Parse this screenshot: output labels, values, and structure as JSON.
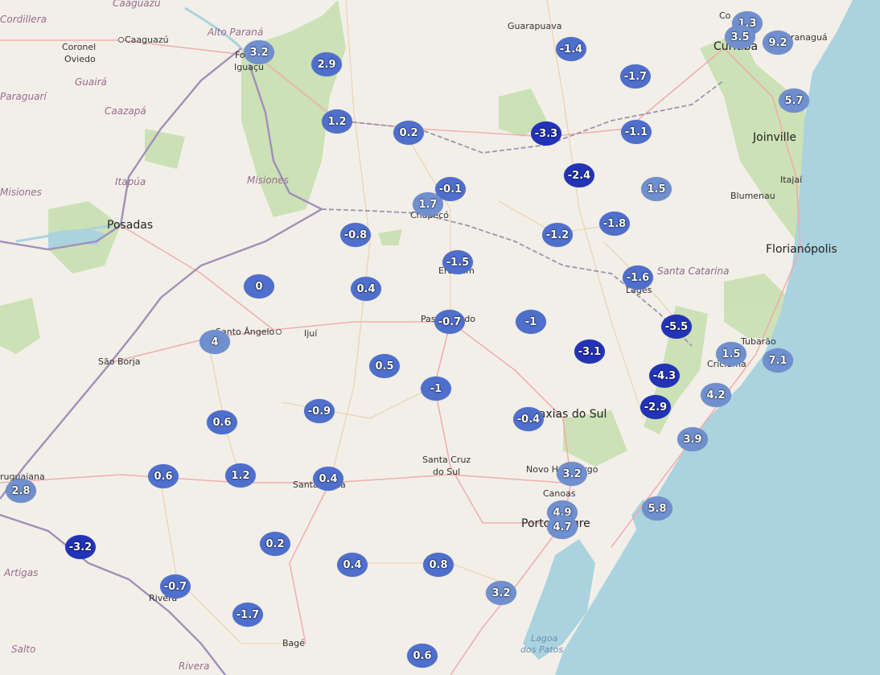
{
  "colors": {
    "land": "#f2efe9",
    "sea": "#aad3df",
    "forest": "#c8dfb0",
    "road_major": "#f2a8a8",
    "road_minor": "#e9c89a",
    "border": "#9d95ad",
    "river": "#aad3df",
    "marker_light": "#6f8fcf",
    "marker_mid": "#4f6fcd",
    "marker_dark": "#2233b8"
  },
  "labels": {
    "caaguazu_region": "Caaguazú",
    "cordillera": "Cordillera",
    "coronel_oviedo_1": "Coronel",
    "coronel_oviedo_2": "Oviedo",
    "caaguazu_city": "Caaguazú",
    "alto_parana": "Alto Paraná",
    "guaira": "Guairá",
    "paraguari": "Paraguarí",
    "caazapa": "Caazapá",
    "foz_1": "Fo",
    "foz_2": "Iguaçu",
    "itapua": "Itapúa",
    "misiones_ar": "Misiones",
    "misiones_py": "Misiones",
    "posadas": "Posadas",
    "guarapuava": "Guarapuava",
    "curitiba": "Curitiba",
    "colombo": "Co",
    "paranagua": "ranaguá",
    "joinville": "Joinville",
    "itajai": "Itajaí",
    "blumenau": "Blumenau",
    "florianopolis": "Florianópolis",
    "chapeco": "Chapecó",
    "erechim": "Erechim",
    "santa_catarina": "Santa Catarina",
    "lages": "Lages",
    "passo_fundo": "Passo Fundo",
    "santo_angelo": "Santo Ângelo",
    "ijui": "Ijuí",
    "sao_borja": "São Borja",
    "tubarao": "Tubarão",
    "criciuma": "Criciúma",
    "caxias": "Caxias do Sul",
    "santa_cruz_1": "Santa Cruz",
    "santa_cruz_2": "do Sul",
    "novo_hamburgo": "Novo Hamburgo",
    "canoas": "Canoas",
    "porto_alegre": "Porto Alegre",
    "uruguaiana": "ruguaiana",
    "santa_maria": "Santa Maria",
    "artigas": "Artigas",
    "rivera_city": "Rivera",
    "rivera_region": "Rivera",
    "salto": "Salto",
    "bage": "Bagé",
    "lagoa_1": "Lagoa",
    "lagoa_2": "dos Patos"
  },
  "markers": [
    {
      "value": "1.3",
      "tone": "light"
    },
    {
      "value": "3.5",
      "tone": "light"
    },
    {
      "value": "9.2",
      "tone": "light"
    },
    {
      "value": "3.2",
      "tone": "light"
    },
    {
      "value": "2.9",
      "tone": "mid"
    },
    {
      "value": "-1.4",
      "tone": "mid"
    },
    {
      "value": "-1.7",
      "tone": "mid"
    },
    {
      "value": "5.7",
      "tone": "light"
    },
    {
      "value": "1.2",
      "tone": "mid"
    },
    {
      "value": "0.2",
      "tone": "mid"
    },
    {
      "value": "-3.3",
      "tone": "dark"
    },
    {
      "value": "-1.1",
      "tone": "mid"
    },
    {
      "value": "-2.4",
      "tone": "dark"
    },
    {
      "value": "1.5",
      "tone": "light"
    },
    {
      "value": "-0.1",
      "tone": "mid"
    },
    {
      "value": "1.7",
      "tone": "light"
    },
    {
      "value": "-0.8",
      "tone": "mid"
    },
    {
      "value": "-1.2",
      "tone": "mid"
    },
    {
      "value": "-1.8",
      "tone": "mid"
    },
    {
      "value": "-1.5",
      "tone": "mid"
    },
    {
      "value": "0",
      "tone": "mid"
    },
    {
      "value": "0.4",
      "tone": "mid"
    },
    {
      "value": "-1.6",
      "tone": "mid"
    },
    {
      "value": "-0.7",
      "tone": "mid"
    },
    {
      "value": "-1",
      "tone": "mid"
    },
    {
      "value": "-5.5",
      "tone": "dark"
    },
    {
      "value": "4",
      "tone": "light"
    },
    {
      "value": "-3.1",
      "tone": "dark"
    },
    {
      "value": "1.5",
      "tone": "light"
    },
    {
      "value": "7.1",
      "tone": "light"
    },
    {
      "value": "0.5",
      "tone": "mid"
    },
    {
      "value": "-4.3",
      "tone": "dark"
    },
    {
      "value": "-1",
      "tone": "mid"
    },
    {
      "value": "4.2",
      "tone": "light"
    },
    {
      "value": "-0.9",
      "tone": "mid"
    },
    {
      "value": "-2.9",
      "tone": "dark"
    },
    {
      "value": "0.6",
      "tone": "mid"
    },
    {
      "value": "-0.4",
      "tone": "mid"
    },
    {
      "value": "3.9",
      "tone": "light"
    },
    {
      "value": "0.6",
      "tone": "mid"
    },
    {
      "value": "1.2",
      "tone": "mid"
    },
    {
      "value": "0.4",
      "tone": "mid"
    },
    {
      "value": "3.2",
      "tone": "light"
    },
    {
      "value": "2.8",
      "tone": "light"
    },
    {
      "value": "5.8",
      "tone": "light"
    },
    {
      "value": "4.9",
      "tone": "light"
    },
    {
      "value": "4.7",
      "tone": "light"
    },
    {
      "value": "-3.2",
      "tone": "dark"
    },
    {
      "value": "0.2",
      "tone": "mid"
    },
    {
      "value": "0.4",
      "tone": "mid"
    },
    {
      "value": "0.8",
      "tone": "mid"
    },
    {
      "value": "-0.7",
      "tone": "mid"
    },
    {
      "value": "3.2",
      "tone": "light"
    },
    {
      "value": "-1.7",
      "tone": "mid"
    },
    {
      "value": "0.6",
      "tone": "mid"
    }
  ]
}
